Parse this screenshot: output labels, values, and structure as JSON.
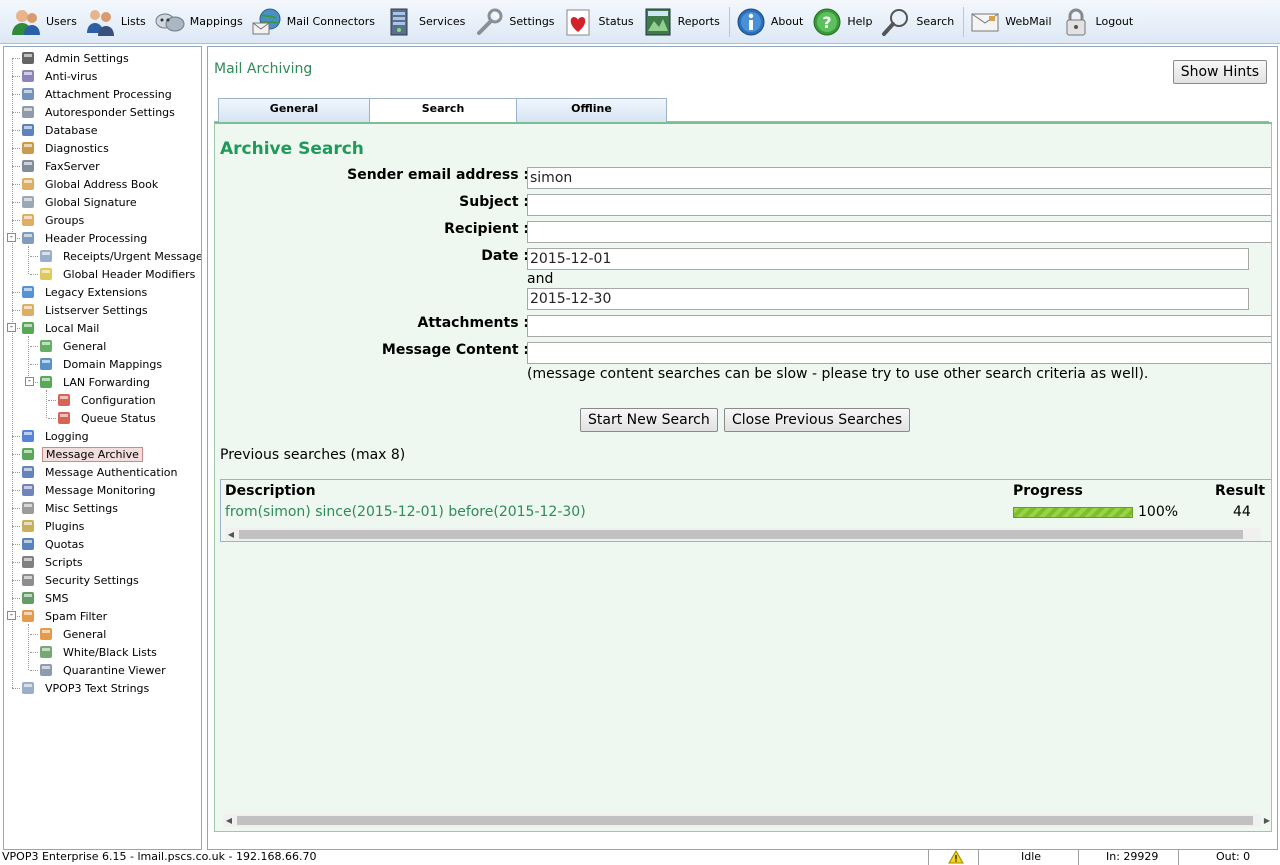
{
  "toolbar": {
    "items": [
      {
        "label": "Users",
        "icon": "users-icon"
      },
      {
        "label": "Lists",
        "icon": "lists-icon"
      },
      {
        "label": "Mappings",
        "icon": "mappings-icon"
      },
      {
        "label": "Mail Connectors",
        "icon": "mail-connectors-icon"
      },
      {
        "label": "Services",
        "icon": "services-icon"
      },
      {
        "label": "Settings",
        "icon": "settings-icon"
      },
      {
        "label": "Status",
        "icon": "status-icon"
      },
      {
        "label": "Reports",
        "icon": "reports-icon"
      },
      {
        "label": "About",
        "icon": "about-icon"
      },
      {
        "label": "Help",
        "icon": "help-icon"
      },
      {
        "label": "Search",
        "icon": "search-icon"
      },
      {
        "label": "WebMail",
        "icon": "webmail-icon"
      },
      {
        "label": "Logout",
        "icon": "logout-icon"
      }
    ]
  },
  "sidebar": {
    "items": [
      {
        "label": "Admin Settings",
        "icon": "admin-icon"
      },
      {
        "label": "Anti-virus",
        "icon": "shield-icon"
      },
      {
        "label": "Attachment Processing",
        "icon": "paperclip-icon"
      },
      {
        "label": "Autoresponder Settings",
        "icon": "gear-icon"
      },
      {
        "label": "Database",
        "icon": "database-icon"
      },
      {
        "label": "Diagnostics",
        "icon": "diagnostics-icon"
      },
      {
        "label": "FaxServer",
        "icon": "fax-icon"
      },
      {
        "label": "Global Address Book",
        "icon": "address-book-icon"
      },
      {
        "label": "Global Signature",
        "icon": "signature-icon"
      },
      {
        "label": "Groups",
        "icon": "groups-icon"
      },
      {
        "label": "Header Processing",
        "icon": "header-icon"
      },
      {
        "label": "Receipts/Urgent Messages",
        "icon": "receipt-icon"
      },
      {
        "label": "Global Header Modifiers",
        "icon": "header-modifier-icon"
      },
      {
        "label": "Legacy Extensions",
        "icon": "puzzle-icon"
      },
      {
        "label": "Listserver Settings",
        "icon": "listserver-icon"
      },
      {
        "label": "Local Mail",
        "icon": "local-mail-icon"
      },
      {
        "label": "General",
        "icon": "general-icon"
      },
      {
        "label": "Domain Mappings",
        "icon": "globe-icon"
      },
      {
        "label": "LAN Forwarding",
        "icon": "lan-icon"
      },
      {
        "label": "Configuration",
        "icon": "configuration-icon"
      },
      {
        "label": "Queue Status",
        "icon": "queue-icon"
      },
      {
        "label": "Logging",
        "icon": "logging-icon"
      },
      {
        "label": "Message Archive",
        "icon": "archive-icon"
      },
      {
        "label": "Message Authentication",
        "icon": "authentication-icon"
      },
      {
        "label": "Message Monitoring",
        "icon": "monitoring-icon"
      },
      {
        "label": "Misc Settings",
        "icon": "wrench-icon"
      },
      {
        "label": "Plugins",
        "icon": "plugin-icon"
      },
      {
        "label": "Quotas",
        "icon": "quota-icon"
      },
      {
        "label": "Scripts",
        "icon": "script-icon"
      },
      {
        "label": "Security Settings",
        "icon": "lock-icon"
      },
      {
        "label": "SMS",
        "icon": "phone-icon"
      },
      {
        "label": "Spam Filter",
        "icon": "spam-icon"
      },
      {
        "label": "General",
        "icon": "spam-general-icon"
      },
      {
        "label": "White/Black Lists",
        "icon": "whitelist-icon"
      },
      {
        "label": "Quarantine Viewer",
        "icon": "quarantine-icon"
      },
      {
        "label": "VPOP3 Text Strings",
        "icon": "text-strings-icon"
      }
    ]
  },
  "main": {
    "title": "Mail Archiving",
    "hints_button": "Show Hints",
    "tabs": [
      {
        "label": "General"
      },
      {
        "label": "Search"
      },
      {
        "label": "Offline"
      }
    ],
    "active_tab": "Search",
    "heading": "Archive Search",
    "form": {
      "sender_label": "Sender email address :",
      "sender_value": "simon",
      "subject_label": "Subject :",
      "subject_value": "",
      "recipient_label": "Recipient :",
      "recipient_value": "",
      "date_label": "Date :",
      "date_from": "2015-12-01",
      "date_and": "and",
      "date_to": "2015-12-30",
      "attachments_label": "Attachments :",
      "attachments_value": "",
      "content_label": "Message Content :",
      "content_value": "",
      "content_hint": "(message content searches can be slow - please try to use other search criteria as well)."
    },
    "buttons": {
      "start": "Start New Search",
      "close": "Close Previous Searches"
    },
    "previous_label": "Previous searches (max 8)",
    "results": {
      "headers": [
        "Description",
        "Progress",
        "Result"
      ],
      "rows": [
        {
          "description": "from(simon) since(2015-12-01) before(2015-12-30)",
          "progress": 1.0,
          "progress_text": "100%",
          "results": "44"
        }
      ]
    }
  },
  "statusbar": {
    "app": "VPOP3 Enterprise 6.15 - lmail.pscs.co.uk - 192.168.66.70",
    "warning_icon": "warning-icon",
    "state": "Idle",
    "in": "In: 29929",
    "out": "Out: 0"
  },
  "colors": {
    "accent_green": "#2e8b57",
    "heading_green": "#1f9a5a",
    "panel_bg": "#eef8f1",
    "toolbar_bg": "#dde8f5"
  }
}
